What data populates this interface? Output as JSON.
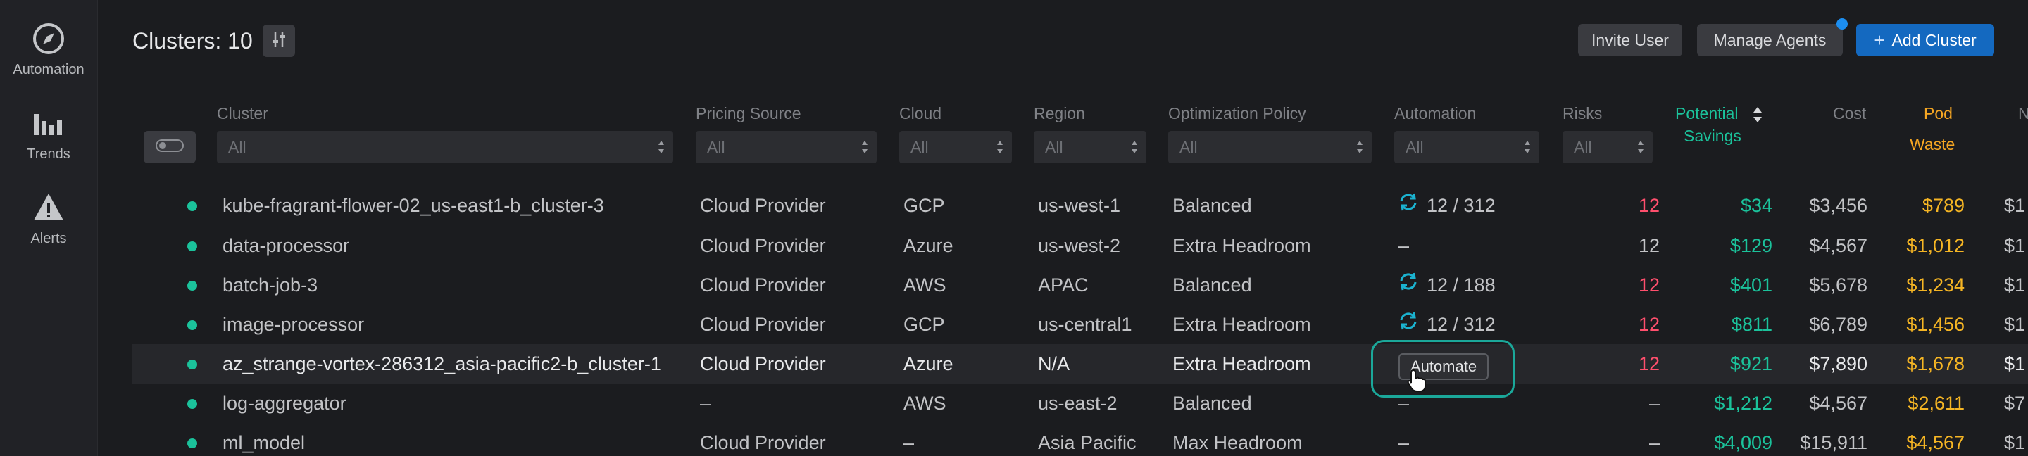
{
  "sidebar": {
    "items": [
      {
        "label": "Automation",
        "icon": "compass-icon"
      },
      {
        "label": "Trends",
        "icon": "bar-chart-icon"
      },
      {
        "label": "Alerts",
        "icon": "warning-icon"
      }
    ]
  },
  "header": {
    "title": "Clusters: 10",
    "invite_user": "Invite User",
    "manage_agents": "Manage Agents",
    "add_cluster": "Add Cluster"
  },
  "columns": {
    "cluster": "Cluster",
    "pricing_source": "Pricing Source",
    "cloud": "Cloud",
    "region": "Region",
    "optimization_policy": "Optimization Policy",
    "automation": "Automation",
    "risks": "Risks",
    "potential_savings_1": "Potential",
    "potential_savings_2": "Savings",
    "cost": "Cost",
    "pod_waste_1": "Pod",
    "pod_waste_2": "Waste",
    "next_partial": "N"
  },
  "filters": {
    "cluster": "All",
    "pricing_source": "All",
    "cloud": "All",
    "region": "All",
    "optimization_policy": "All",
    "automation": "All",
    "risks": "All"
  },
  "rows": [
    {
      "cluster": "kube-fragrant-flower-02_us-east1-b_cluster-3",
      "pricing": "Cloud Provider",
      "cloud": "GCP",
      "region": "us-west-1",
      "policy": "Balanced",
      "automation": "12 / 312",
      "auto_icon": true,
      "risks": "12",
      "risks_red": true,
      "savings": "$34",
      "cost": "$3,456",
      "waste": "$789",
      "next": "$1"
    },
    {
      "cluster": "data-processor",
      "pricing": "Cloud Provider",
      "cloud": "Azure",
      "region": "us-west-2",
      "policy": "Extra Headroom",
      "automation": "–",
      "auto_icon": false,
      "risks": "12",
      "risks_red": false,
      "savings": "$129",
      "cost": "$4,567",
      "waste": "$1,012",
      "next": "$1"
    },
    {
      "cluster": "batch-job-3",
      "pricing": "Cloud Provider",
      "cloud": "AWS",
      "region": "APAC",
      "policy": "Balanced",
      "automation": "12 / 188",
      "auto_icon": true,
      "risks": "12",
      "risks_red": true,
      "savings": "$401",
      "cost": "$5,678",
      "waste": "$1,234",
      "next": "$1"
    },
    {
      "cluster": "image-processor",
      "pricing": "Cloud Provider",
      "cloud": "GCP",
      "region": "us-central1",
      "policy": "Extra Headroom",
      "automation": "12 / 312",
      "auto_icon": true,
      "risks": "12",
      "risks_red": true,
      "savings": "$811",
      "cost": "$6,789",
      "waste": "$1,456",
      "next": "$1"
    },
    {
      "cluster": "az_strange-vortex-286312_asia-pacific2-b_cluster-1",
      "pricing": "Cloud Provider",
      "cloud": "Azure",
      "region": "N/A",
      "policy": "Extra Headroom",
      "automation": "",
      "auto_icon": false,
      "risks": "12",
      "risks_red": true,
      "savings": "$921",
      "cost": "$7,890",
      "waste": "$1,678",
      "next": "$1"
    },
    {
      "cluster": "log-aggregator",
      "pricing": "–",
      "cloud": "AWS",
      "region": "us-east-2",
      "policy": "Balanced",
      "automation": "–",
      "auto_icon": false,
      "risks": "–",
      "risks_red": false,
      "savings": "$1,212",
      "cost": "$4,567",
      "waste": "$2,611",
      "next": "$7"
    },
    {
      "cluster": "ml_model",
      "pricing": "Cloud Provider",
      "cloud": "–",
      "region": "Asia Pacific",
      "policy": "Max Headroom",
      "automation": "–",
      "auto_icon": false,
      "risks": "–",
      "risks_red": false,
      "savings": "$4,009",
      "cost": "$15,911",
      "waste": "$4,567",
      "next": "$1"
    }
  ],
  "automate_button": "Automate",
  "colors": {
    "accent_green": "#1bc29b",
    "risk_red": "#ff4f6d",
    "waste_orange": "#f5b524",
    "primary_blue": "#1469c0"
  }
}
